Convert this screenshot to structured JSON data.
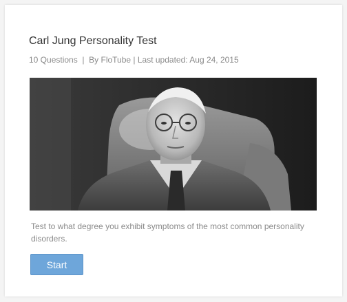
{
  "quiz": {
    "title": "Carl Jung Personality Test",
    "meta": "10 Questions  |  By FloTube | Last updated: Aug 24, 2015",
    "image_alt": "Portrait of Carl Jung",
    "description": "Test to what degree you exhibit symptoms of the most common personality disorders.",
    "start_label": "Start"
  },
  "colors": {
    "accent": "#6ea6da",
    "title_text": "#333333",
    "meta_text": "#8a8a8a"
  }
}
